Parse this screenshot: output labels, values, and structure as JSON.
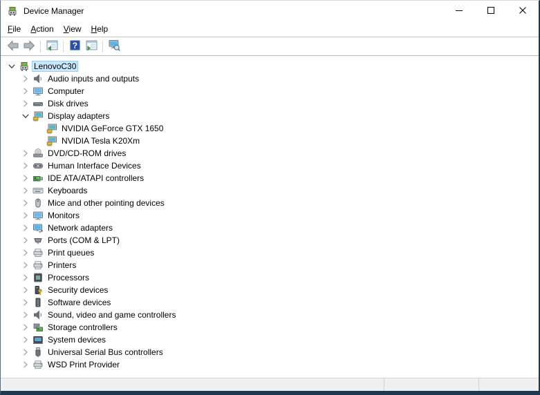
{
  "window": {
    "title": "Device Manager",
    "app_icon": "device-manager-icon",
    "controls": [
      {
        "name": "minimize",
        "icon": "minimize-icon"
      },
      {
        "name": "maximize",
        "icon": "maximize-icon"
      },
      {
        "name": "close",
        "icon": "close-icon"
      }
    ]
  },
  "menu": {
    "items": [
      {
        "label": "File",
        "underline": 0
      },
      {
        "label": "Action",
        "underline": 0
      },
      {
        "label": "View",
        "underline": 0
      },
      {
        "label": "Help",
        "underline": 0
      }
    ]
  },
  "toolbar": {
    "buttons": [
      {
        "name": "back",
        "icon": "back-arrow-icon",
        "group": 1
      },
      {
        "name": "forward",
        "icon": "forward-arrow-icon",
        "group": 1
      },
      {
        "name": "show-hide-console-tree",
        "icon": "console-tree-icon",
        "group": 2
      },
      {
        "name": "help",
        "icon": "help-icon",
        "group": 3
      },
      {
        "name": "show-hide-action-pane",
        "icon": "action-pane-icon",
        "group": 3
      },
      {
        "name": "scan-for-hardware-changes",
        "icon": "scan-hardware-icon",
        "group": 4
      }
    ]
  },
  "tree": {
    "items": [
      {
        "label": "LenovoC30",
        "level": 0,
        "state": "expanded",
        "icon": "device-manager-icon",
        "selected": true
      },
      {
        "label": "Audio inputs and outputs",
        "level": 1,
        "state": "collapsed",
        "icon": "speaker-icon",
        "selected": false
      },
      {
        "label": "Computer",
        "level": 1,
        "state": "collapsed",
        "icon": "monitor-icon",
        "selected": false
      },
      {
        "label": "Disk drives",
        "level": 1,
        "state": "collapsed",
        "icon": "disk-icon",
        "selected": false
      },
      {
        "label": "Display adapters",
        "level": 1,
        "state": "expanded",
        "icon": "display-adapter-icon",
        "selected": false
      },
      {
        "label": "NVIDIA GeForce GTX 1650",
        "level": 2,
        "state": "leaf",
        "icon": "display-adapter-icon",
        "selected": false
      },
      {
        "label": "NVIDIA Tesla K20Xm",
        "level": 2,
        "state": "leaf",
        "icon": "display-adapter-icon",
        "selected": false
      },
      {
        "label": "DVD/CD-ROM drives",
        "level": 1,
        "state": "collapsed",
        "icon": "dvd-icon",
        "selected": false
      },
      {
        "label": "Human Interface Devices",
        "level": 1,
        "state": "collapsed",
        "icon": "hid-icon",
        "selected": false
      },
      {
        "label": "IDE ATA/ATAPI controllers",
        "level": 1,
        "state": "collapsed",
        "icon": "ide-icon",
        "selected": false
      },
      {
        "label": "Keyboards",
        "level": 1,
        "state": "collapsed",
        "icon": "keyboard-icon",
        "selected": false
      },
      {
        "label": "Mice and other pointing devices",
        "level": 1,
        "state": "collapsed",
        "icon": "mouse-icon",
        "selected": false
      },
      {
        "label": "Monitors",
        "level": 1,
        "state": "collapsed",
        "icon": "monitor-icon",
        "selected": false
      },
      {
        "label": "Network adapters",
        "level": 1,
        "state": "collapsed",
        "icon": "network-icon",
        "selected": false
      },
      {
        "label": "Ports (COM & LPT)",
        "level": 1,
        "state": "collapsed",
        "icon": "ports-icon",
        "selected": false
      },
      {
        "label": "Print queues",
        "level": 1,
        "state": "collapsed",
        "icon": "printer-icon",
        "selected": false
      },
      {
        "label": "Printers",
        "level": 1,
        "state": "collapsed",
        "icon": "printer-icon",
        "selected": false
      },
      {
        "label": "Processors",
        "level": 1,
        "state": "collapsed",
        "icon": "cpu-icon",
        "selected": false
      },
      {
        "label": "Security devices",
        "level": 1,
        "state": "collapsed",
        "icon": "security-icon",
        "selected": false
      },
      {
        "label": "Software devices",
        "level": 1,
        "state": "collapsed",
        "icon": "software-icon",
        "selected": false
      },
      {
        "label": "Sound, video and game controllers",
        "level": 1,
        "state": "collapsed",
        "icon": "speaker-icon",
        "selected": false
      },
      {
        "label": "Storage controllers",
        "level": 1,
        "state": "collapsed",
        "icon": "storage-icon",
        "selected": false
      },
      {
        "label": "System devices",
        "level": 1,
        "state": "collapsed",
        "icon": "system-icon",
        "selected": false
      },
      {
        "label": "Universal Serial Bus controllers",
        "level": 1,
        "state": "collapsed",
        "icon": "usb-icon",
        "selected": false
      },
      {
        "label": "WSD Print Provider",
        "level": 1,
        "state": "collapsed",
        "icon": "printer-icon",
        "selected": false
      }
    ]
  },
  "statusbar": {
    "panes": [
      "",
      "",
      ""
    ]
  },
  "colors": {
    "selection_bg": "#cce8ff",
    "selection_border": "#98ccf0",
    "window_border": "#1b3a52",
    "statusbar_bg": "#f0f0f0"
  }
}
